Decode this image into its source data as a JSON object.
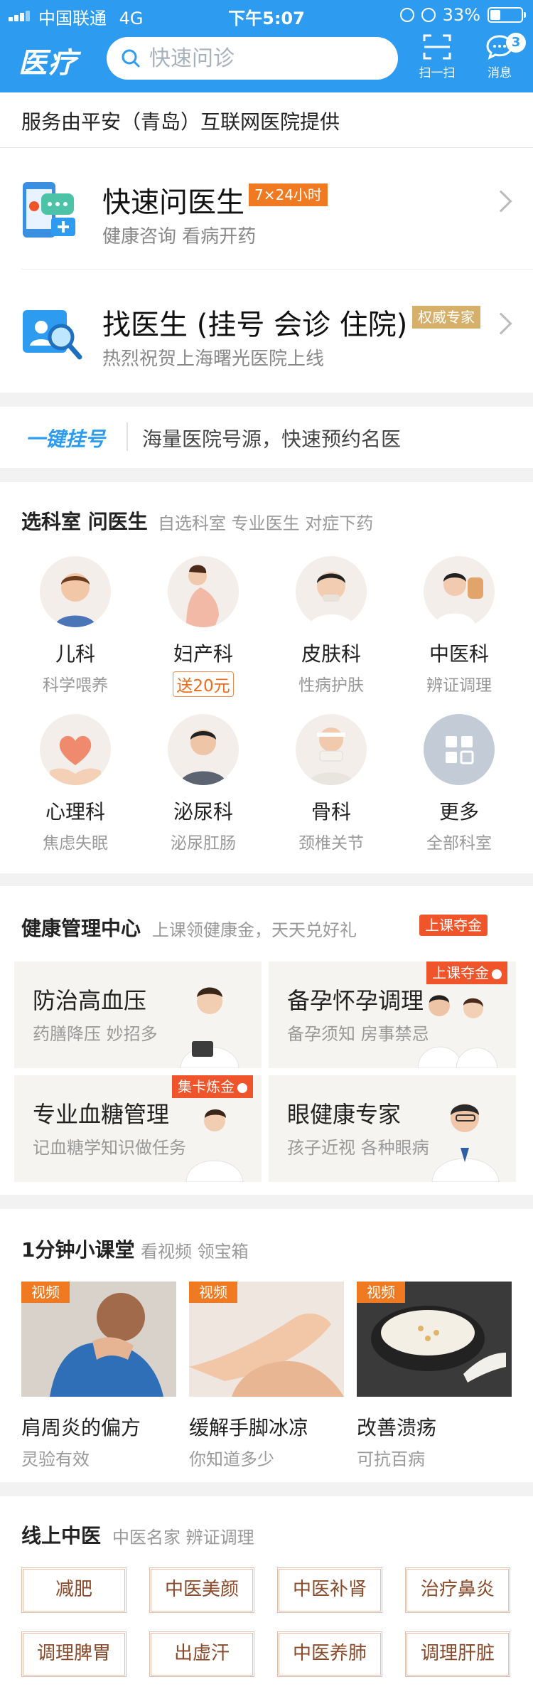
{
  "status_bar": {
    "carrier": "中国联通",
    "network": "4G",
    "time": "下午5:07",
    "battery": "33%",
    "battery_level": 0.33
  },
  "nav": {
    "logo": "医疗",
    "search_placeholder": "快速问诊",
    "scan_label": "扫一扫",
    "message_label": "消息",
    "message_badge": "3"
  },
  "provider_notice": "服务由平安（青岛）互联网医院提供",
  "entries": [
    {
      "title": "快速问医生",
      "tag": "7×24小时",
      "subtitle": "健康咨询 看病开药",
      "tag_color": "#f07a22"
    },
    {
      "title": "找医生 (挂号 会诊 住院)",
      "tag": "权威专家",
      "subtitle": "热烈祝贺上海曙光医院上线",
      "tag_color": "#d6b06a"
    }
  ],
  "quick_register": {
    "label": "一键挂号",
    "text": "海量医院号源，快速预约名医"
  },
  "departments": {
    "title": "选科室 问医生",
    "subtitle": "自选科室 专业医生 对症下药",
    "items": [
      {
        "name": "儿科",
        "desc": "科学喂养"
      },
      {
        "name": "妇产科",
        "desc": "送20元"
      },
      {
        "name": "皮肤科",
        "desc": "性病护肤"
      },
      {
        "name": "中医科",
        "desc": "辨证调理"
      },
      {
        "name": "心理科",
        "desc": "焦虑失眠"
      },
      {
        "name": "泌尿科",
        "desc": "泌尿肛肠"
      },
      {
        "name": "骨科",
        "desc": "颈椎关节"
      },
      {
        "name": "更多",
        "desc": "全部科室"
      }
    ]
  },
  "health": {
    "title": "健康管理中心",
    "subtitle": "上课领健康金，天天兑好礼",
    "badge": "上课夺金",
    "tiles": [
      {
        "title": "防治高血压",
        "subtitle": "药膳降压 妙招多",
        "tag": ""
      },
      {
        "title": "备孕怀孕调理",
        "subtitle": "备孕须知 房事禁忌",
        "tag": "上课夺金"
      },
      {
        "title": "专业血糖管理",
        "subtitle": "记血糖学知识做任务",
        "tag": "集卡炼金"
      },
      {
        "title": "眼健康专家",
        "subtitle": "孩子近视 各种眼病",
        "tag": ""
      }
    ]
  },
  "videos": {
    "title": "1分钟小课堂",
    "subtitle": "看视频 领宝箱",
    "tag": "视频",
    "items": [
      {
        "title": "肩周炎的偏方",
        "subtitle": "灵验有效"
      },
      {
        "title": "缓解手脚冰凉",
        "subtitle": "你知道多少"
      },
      {
        "title": "改善溃疡",
        "subtitle": "可抗百病"
      }
    ]
  },
  "tcm": {
    "title": "线上中医",
    "subtitle": "中医名家 辨证调理",
    "chips": [
      "减肥",
      "中医美颜",
      "中医补肾",
      "治疗鼻炎",
      "调理脾胃",
      "出虚汗",
      "中医养肺",
      "调理肝脏"
    ]
  },
  "colors": {
    "brand": "#2d9cf0",
    "accent": "#f07a22",
    "tag_red": "#f0542a"
  }
}
